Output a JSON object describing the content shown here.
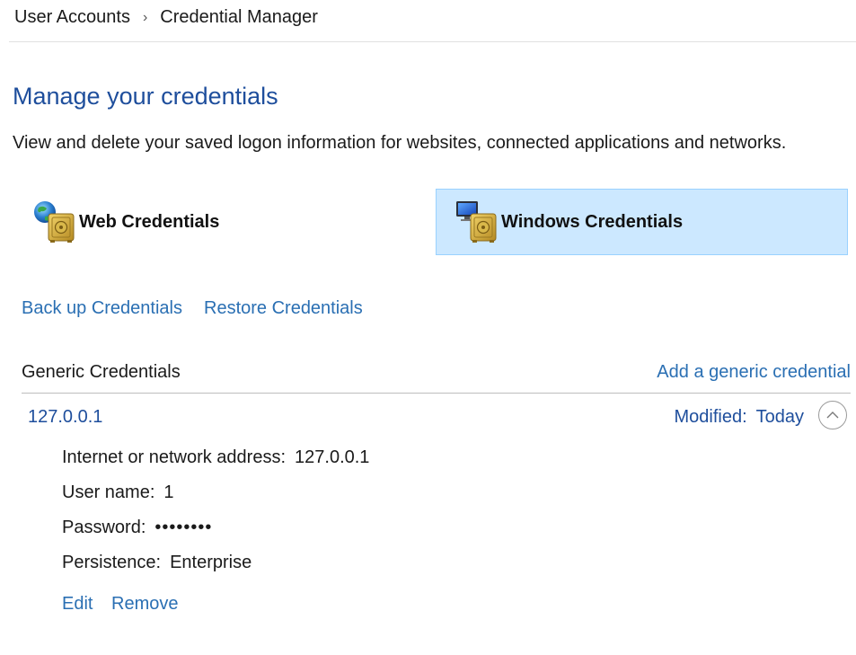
{
  "breadcrumb": {
    "items": [
      "User Accounts",
      "Credential Manager"
    ],
    "separator": "›"
  },
  "page": {
    "title": "Manage your credentials",
    "description": "View and delete your saved logon information for websites, connected applications and networks."
  },
  "tiles": {
    "web": {
      "label": "Web Credentials",
      "selected": false,
      "icon": "globe-vault-icon"
    },
    "windows": {
      "label": "Windows Credentials",
      "selected": true,
      "icon": "monitor-vault-icon"
    }
  },
  "actions": {
    "backup": "Back up Credentials",
    "restore": "Restore Credentials"
  },
  "generic": {
    "section_title": "Generic Credentials",
    "add_link": "Add a generic credential",
    "entry": {
      "name": "127.0.0.1",
      "modified_label": "Modified:",
      "modified_value": "Today",
      "expanded": true,
      "details": {
        "address_label": "Internet or network address:",
        "address_value": "127.0.0.1",
        "username_label": "User name:",
        "username_value": "1",
        "password_label": "Password:",
        "password_value": "••••••••",
        "persistence_label": "Persistence:",
        "persistence_value": "Enterprise"
      },
      "edit_label": "Edit",
      "remove_label": "Remove"
    }
  },
  "colors": {
    "heading_blue": "#1e4e9c",
    "link_blue": "#2a6fb3",
    "selected_tile_bg": "#cce8ff",
    "selected_tile_border": "#99d1ff"
  }
}
